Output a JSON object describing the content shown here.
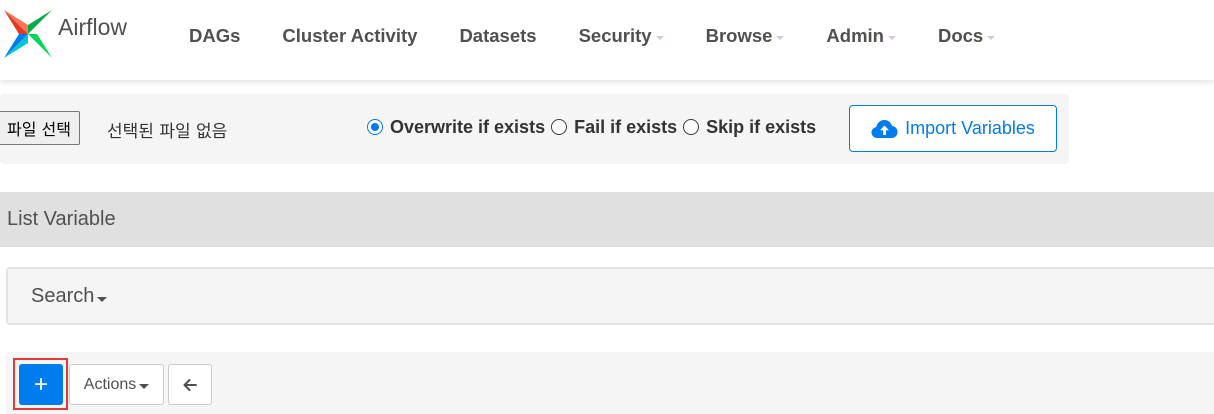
{
  "navbar": {
    "brand": "Airflow",
    "items": [
      {
        "label": "DAGs",
        "dropdown": false
      },
      {
        "label": "Cluster Activity",
        "dropdown": false
      },
      {
        "label": "Datasets",
        "dropdown": false
      },
      {
        "label": "Security",
        "dropdown": true
      },
      {
        "label": "Browse",
        "dropdown": true
      },
      {
        "label": "Admin",
        "dropdown": true
      },
      {
        "label": "Docs",
        "dropdown": true
      }
    ]
  },
  "import": {
    "file_button": "파일 선택",
    "file_status": "선택된 파일 없음",
    "options": [
      {
        "label": "Overwrite if exists",
        "checked": true
      },
      {
        "label": "Fail if exists",
        "checked": false
      },
      {
        "label": "Skip if exists",
        "checked": false
      }
    ],
    "import_button": "Import Variables",
    "icon": "cloud-upload-icon"
  },
  "list": {
    "title": "List Variable"
  },
  "search": {
    "label": "Search"
  },
  "toolbar": {
    "add_label": "+",
    "actions_label": "Actions",
    "back_icon": "arrow-left-icon"
  },
  "colors": {
    "primary": "#017cee",
    "highlight": "#e53935",
    "nav_text": "#51504f"
  }
}
